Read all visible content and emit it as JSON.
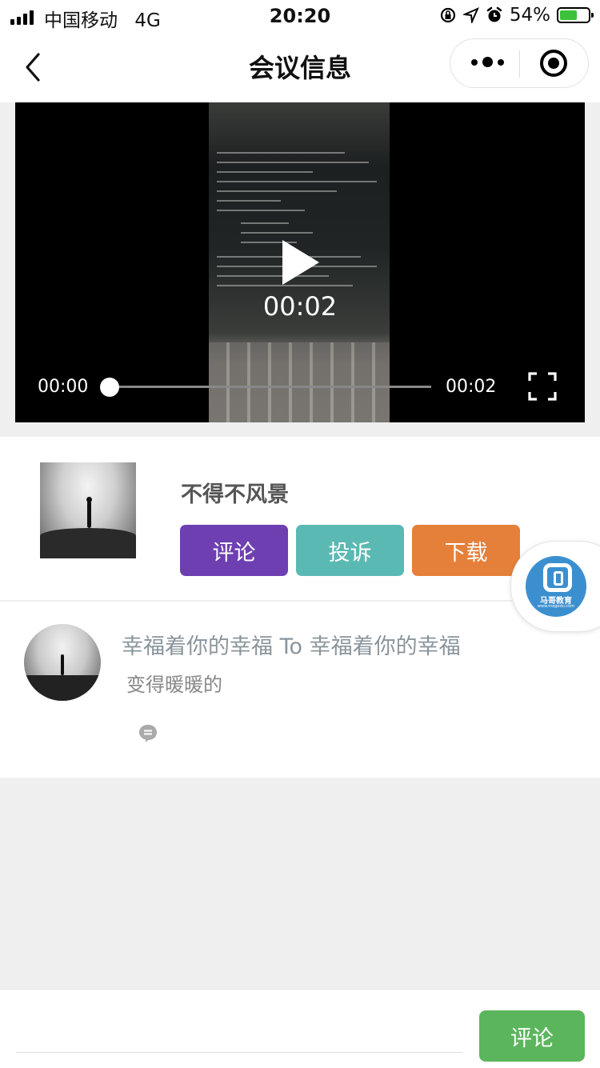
{
  "status_bar": {
    "carrier": "中国移动",
    "network": "4G",
    "time": "20:20",
    "battery": "54%"
  },
  "nav": {
    "title": "会议信息"
  },
  "video": {
    "center_time": "00:02",
    "current_time": "00:00",
    "duration": "00:02",
    "progress": 0
  },
  "meeting": {
    "name": "不得不风景",
    "buttons": {
      "comment": "评论",
      "complain": "投诉",
      "download": "下载"
    }
  },
  "floating_logo": {
    "name": "马哥教育",
    "url": "www.magedu.com"
  },
  "comment": {
    "header": "幸福着你的幸福 To 幸福着你的幸福",
    "text": "变得暖暖的"
  },
  "bottom": {
    "submit_label": "评论"
  },
  "colors": {
    "comment_button": "#6d3fb1",
    "complain_button": "#5ab9b2",
    "download_button": "#e5803a",
    "submit_button": "#5bb55c",
    "logo": "#3b8fcf"
  }
}
